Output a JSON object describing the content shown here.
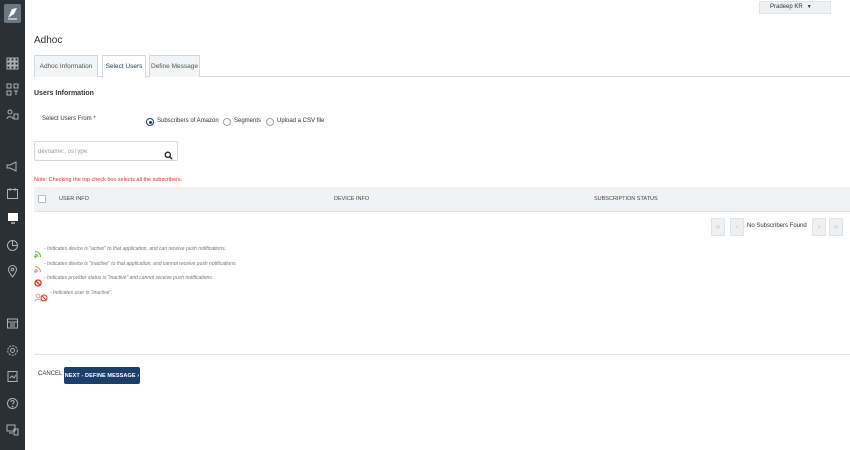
{
  "header": {
    "user_name": "Pradeep KR"
  },
  "page": {
    "title": "Adhoc"
  },
  "tabs": [
    {
      "label": "Adhoc Information"
    },
    {
      "label": "Select Users"
    },
    {
      "label": "Define Message"
    }
  ],
  "users_info": {
    "section_title": "Users Information",
    "select_label": "Select Users From *",
    "options": [
      {
        "label": "Subscribers of Amazon",
        "selected": true
      },
      {
        "label": "Segments",
        "selected": false
      },
      {
        "label": "Upload a CSV file",
        "selected": false
      }
    ]
  },
  "search": {
    "placeholder": "devname:, osType:",
    "value": ""
  },
  "note": "Note: Checking the top check box selects all the subscribers.",
  "table": {
    "columns": [
      "USER INFO",
      "DEVICE INFO",
      "SUBSCRIPTION STATUS"
    ]
  },
  "pagination": {
    "status": "No Subscribers Found"
  },
  "legend": [
    {
      "icon": "rss-active-icon",
      "text": "- Indicates device is \"active\" to that application, and can receive push notifications."
    },
    {
      "icon": "rss-inactive-icon",
      "text": "- Indicates device is \"inactive\" to that application, and cannot receive push notifications."
    },
    {
      "icon": "provider-inactive-icon",
      "text": "- Indicates provider status is \"inactive\" and cannot receive push notifications."
    },
    {
      "icon": "user-inactive-icon",
      "text": "- Indicates user is \"inactive\"."
    }
  ],
  "footer": {
    "cancel_label": "CANCEL",
    "next_label": "NEXT - DEFINE MESSAGE ›"
  },
  "colors": {
    "sidebar": "#2b3035",
    "primary": "#1b3f6b",
    "note": "#d9341f",
    "active_green": "#6bbf3b",
    "inactive_red": "#e0301e"
  }
}
